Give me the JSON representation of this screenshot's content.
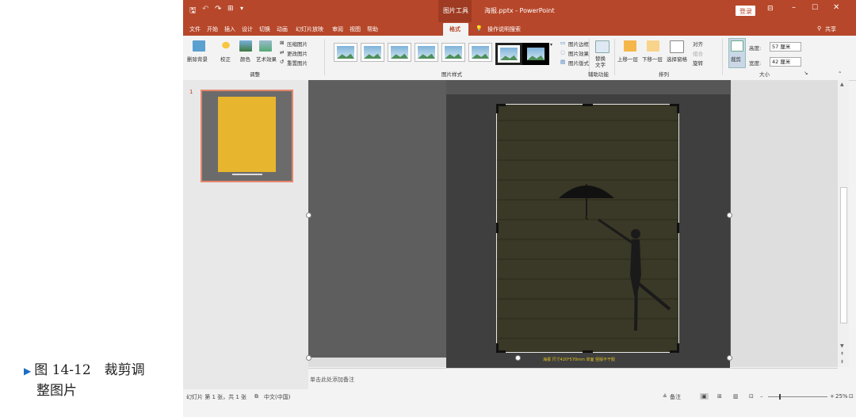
{
  "caption": {
    "line1": "图 14-12　裁剪调",
    "line2": "整图片"
  },
  "titlebar": {
    "context_tool": "图片工具",
    "doc_title": "海报.pptx - PowerPoint",
    "login": "登录"
  },
  "tabs": [
    "文件",
    "开始",
    "插入",
    "设计",
    "切换",
    "动画",
    "幻灯片放映",
    "审阅",
    "视图",
    "帮助",
    "格式"
  ],
  "tell_me": "操作说明搜索",
  "share": "共享",
  "ribbon": {
    "remove_bg": "删除背景",
    "correct": "校正",
    "color": "颜色",
    "art_effects": "艺术效果",
    "compress": "压缩图片",
    "change_pic": "更改图片",
    "reset_pic": "重置图片",
    "group_adjust": "调整",
    "border": "图片边框",
    "effects": "图片效果",
    "layout": "图片版式",
    "group_styles": "图片样式",
    "alt_text1": "替换",
    "alt_text2": "文字",
    "group_access": "辅助功能",
    "bring_fwd": "上移一层",
    "send_back": "下移一层",
    "select_pane": "选择窗格",
    "align": "对齐",
    "group_obj": "组合",
    "rotate": "旋转",
    "group_arrange": "排列",
    "crop": "裁剪",
    "height_lbl": "高度:",
    "height_val": "57 厘米",
    "width_lbl": "宽度:",
    "width_val": "42 厘米",
    "group_size": "大小"
  },
  "slide_panel": {
    "number": "1"
  },
  "slide": {
    "poster_caption": "海报 尺寸420*570mm 单面 竖版不干胶"
  },
  "notes_placeholder": "单击此处添加备注",
  "status": {
    "slide_info": "幻灯片 第 1 张，共 1 张",
    "language": "中文(中国)",
    "notes_btn": "备注",
    "zoom": "25%"
  }
}
